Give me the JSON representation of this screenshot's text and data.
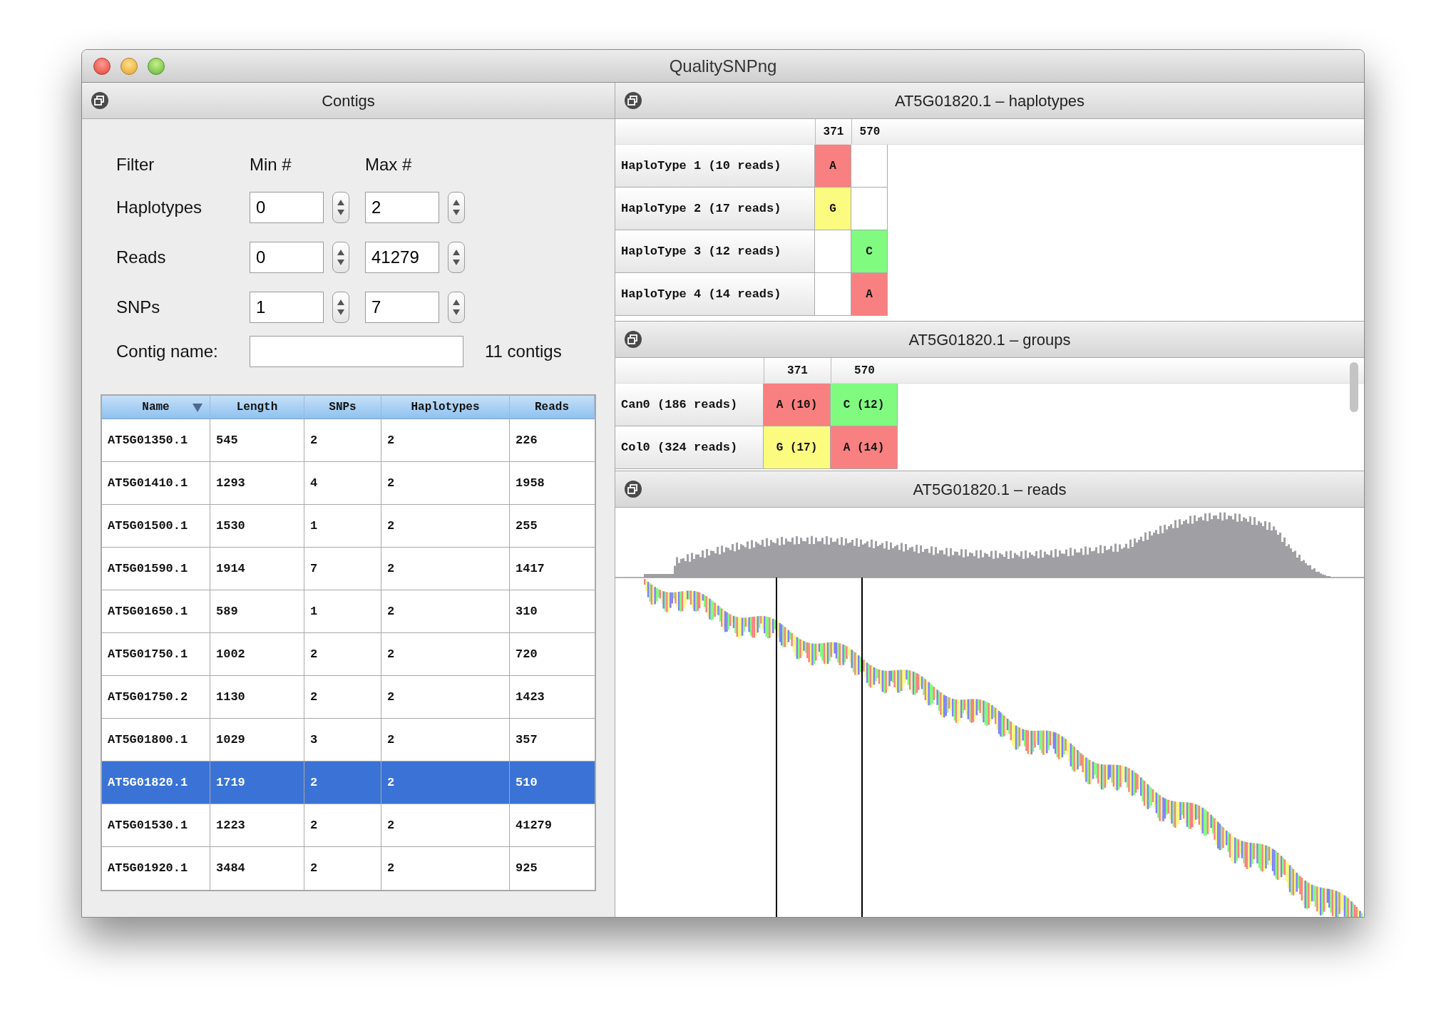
{
  "window": {
    "title": "QualitySNPng"
  },
  "contigs_panel": {
    "title": "Contigs",
    "filter_headers": [
      "Filter",
      "Min #",
      "Max #"
    ],
    "filters": [
      {
        "label": "Haplotypes",
        "min": "0",
        "max": "2"
      },
      {
        "label": "Reads",
        "min": "0",
        "max": "41279"
      },
      {
        "label": "SNPs",
        "min": "1",
        "max": "7"
      }
    ],
    "name_filter": {
      "label": "Contig name:"
    },
    "count": "11 contigs",
    "table": {
      "columns": [
        {
          "label": "Name",
          "sorted": true
        },
        {
          "label": "Length",
          "sorted": false
        },
        {
          "label": "SNPs",
          "sorted": false
        },
        {
          "label": "Haplotypes",
          "sorted": false
        },
        {
          "label": "Reads",
          "sorted": false
        }
      ],
      "rows": [
        {
          "cells": [
            "AT5G01350.1",
            "545",
            "2",
            "2",
            "226"
          ],
          "selected": false
        },
        {
          "cells": [
            "AT5G01410.1",
            "1293",
            "4",
            "2",
            "1958"
          ],
          "selected": false
        },
        {
          "cells": [
            "AT5G01500.1",
            "1530",
            "1",
            "2",
            "255"
          ],
          "selected": false
        },
        {
          "cells": [
            "AT5G01590.1",
            "1914",
            "7",
            "2",
            "1417"
          ],
          "selected": false
        },
        {
          "cells": [
            "AT5G01650.1",
            "589",
            "1",
            "2",
            "310"
          ],
          "selected": false
        },
        {
          "cells": [
            "AT5G01750.1",
            "1002",
            "2",
            "2",
            "720"
          ],
          "selected": false
        },
        {
          "cells": [
            "AT5G01750.2",
            "1130",
            "2",
            "2",
            "1423"
          ],
          "selected": false
        },
        {
          "cells": [
            "AT5G01800.1",
            "1029",
            "3",
            "2",
            "357"
          ],
          "selected": false
        },
        {
          "cells": [
            "AT5G01820.1",
            "1719",
            "2",
            "2",
            "510"
          ],
          "selected": true
        },
        {
          "cells": [
            "AT5G01530.1",
            "1223",
            "2",
            "2",
            "41279"
          ],
          "selected": false
        },
        {
          "cells": [
            "AT5G01920.1",
            "3484",
            "2",
            "2",
            "925"
          ],
          "selected": false
        }
      ]
    }
  },
  "haplotypes_panel": {
    "title": "AT5G01820.1 – haplotypes",
    "positions": [
      "371",
      "570"
    ],
    "rows": [
      {
        "label": "HaploType 1 (10 reads)",
        "cells": [
          {
            "text": "A",
            "color": "#f98080"
          },
          null
        ]
      },
      {
        "label": "HaploType 2 (17 reads)",
        "cells": [
          {
            "text": "G",
            "color": "#fbfb80"
          },
          null
        ]
      },
      {
        "label": "HaploType 3 (12 reads)",
        "cells": [
          null,
          {
            "text": "C",
            "color": "#80fb80"
          }
        ]
      },
      {
        "label": "HaploType 4 (14 reads)",
        "cells": [
          null,
          {
            "text": "A",
            "color": "#f98080"
          }
        ]
      }
    ]
  },
  "groups_panel": {
    "title": "AT5G01820.1 – groups",
    "positions": [
      "371",
      "570"
    ],
    "rows": [
      {
        "label": "Can0 (186 reads)",
        "cells": [
          {
            "text": "A (10)",
            "color": "#f98080"
          },
          {
            "text": "C (12)",
            "color": "#80fb80"
          }
        ]
      },
      {
        "label": "Col0 (324 reads)",
        "cells": [
          {
            "text": "G (17)",
            "color": "#fbfb80"
          },
          {
            "text": "A (14)",
            "color": "#f98080"
          }
        ]
      }
    ]
  },
  "reads_panel": {
    "title": "AT5G01820.1 – reads"
  }
}
